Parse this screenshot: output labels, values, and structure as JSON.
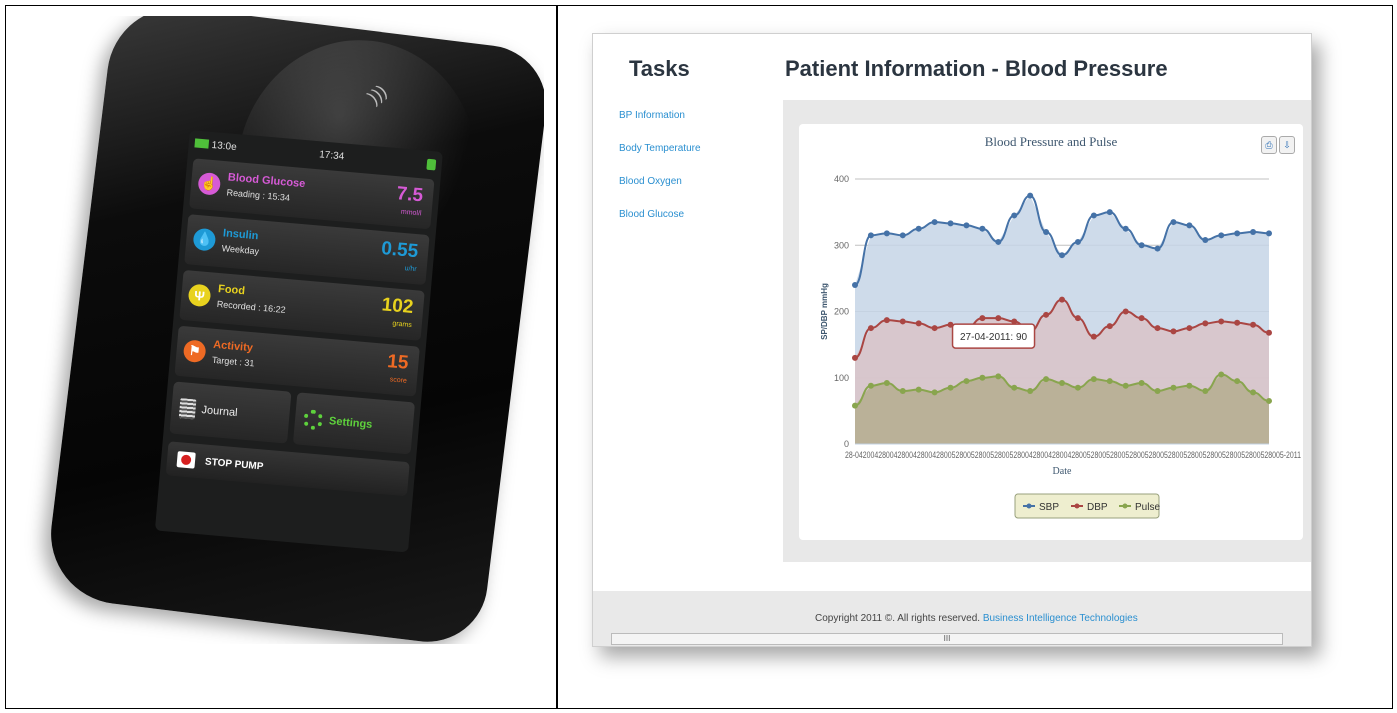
{
  "device": {
    "status_time_left": "13:0e",
    "status_time": "17:34",
    "tiles": [
      {
        "title": "Blood Glucose",
        "sub": "Reading : 15:34",
        "value": "7.5",
        "unit": "mmol/l",
        "color": "#d65ad6",
        "icon": "hand-icon"
      },
      {
        "title": "Insulin",
        "sub": "Weekday",
        "value": "0.55",
        "unit": "u/hr",
        "color": "#1e9ad6",
        "icon": "drop-icon"
      },
      {
        "title": "Food",
        "sub": "Recorded : 16:22",
        "value": "102",
        "unit": "grams",
        "color": "#e8d21e",
        "icon": "fork-icon"
      },
      {
        "title": "Activity",
        "sub": "Target : 31",
        "value": "15",
        "unit": "score",
        "color": "#ee6a24",
        "icon": "runner-icon"
      }
    ],
    "journal_label": "Journal",
    "settings_label": "Settings",
    "stop_label": "STOP PUMP"
  },
  "app": {
    "tasks_title": "Tasks",
    "page_title": "Patient Information - Blood Pressure",
    "nav": [
      "BP Information",
      "Body Temperature",
      "Blood Oxygen",
      "Blood Glucose"
    ],
    "footer_text": "Copyright 2011 ©. All rights reserved.",
    "footer_company": "Business Intelligence Technologies",
    "scroll_glyph": "III"
  },
  "chart_data": {
    "type": "area",
    "title": "Blood Pressure and Pulse",
    "xlabel": "Date",
    "ylabel": "SP/DBP mmHg",
    "ylim": [
      0,
      400
    ],
    "yticks": [
      0,
      100,
      200,
      300,
      400
    ],
    "x_axis_text_left": "28-04",
    "x_axis_text_right": "-2011",
    "grid": true,
    "legend_placement": "bottom-center",
    "tooltip": "27-04-2011: 90",
    "series": [
      {
        "name": "SBP",
        "color": "#4572a7",
        "fill": "#c6d5e6",
        "values": [
          240,
          315,
          318,
          315,
          325,
          335,
          333,
          330,
          325,
          305,
          345,
          375,
          320,
          285,
          305,
          345,
          350,
          325,
          300,
          295,
          335,
          330,
          308,
          315,
          318,
          320,
          318
        ]
      },
      {
        "name": "DBP",
        "color": "#aa4643",
        "fill": "#d9c3c8",
        "values": [
          130,
          175,
          187,
          185,
          182,
          175,
          180,
          175,
          190,
          190,
          185,
          170,
          195,
          218,
          190,
          162,
          178,
          200,
          190,
          175,
          170,
          175,
          182,
          185,
          183,
          180,
          168
        ]
      },
      {
        "name": "Pulse",
        "color": "#89a54e",
        "fill": "#b5ad8e",
        "values": [
          58,
          88,
          92,
          80,
          82,
          78,
          85,
          95,
          100,
          102,
          85,
          80,
          98,
          92,
          85,
          98,
          95,
          88,
          92,
          80,
          85,
          88,
          80,
          105,
          95,
          78,
          65
        ]
      }
    ]
  }
}
